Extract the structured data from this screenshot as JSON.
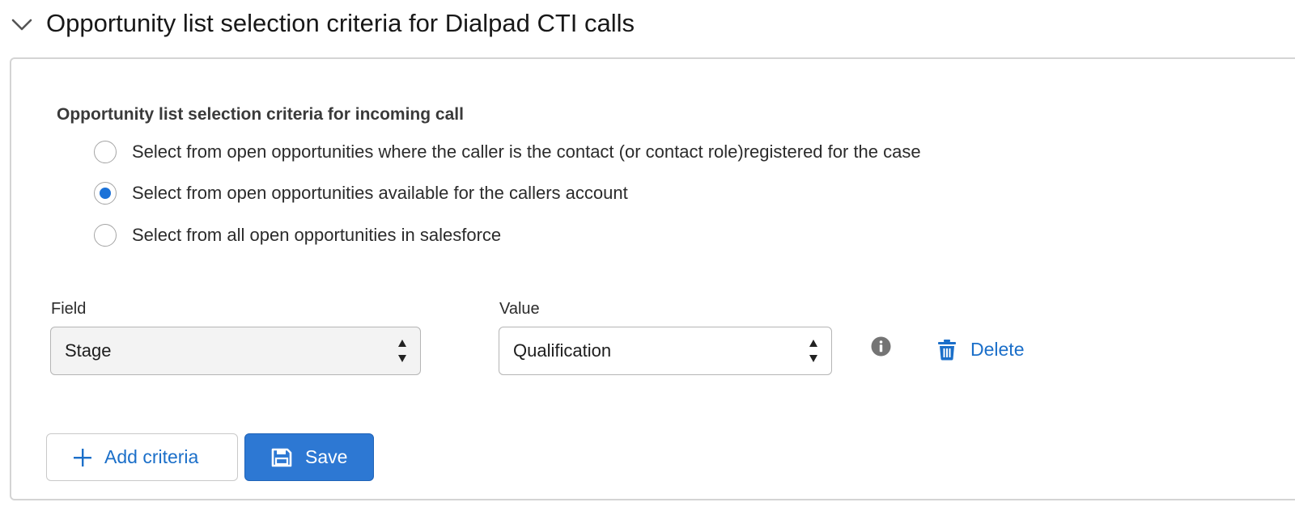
{
  "section": {
    "title": "Opportunity list selection criteria for Dialpad CTI calls",
    "expanded": true
  },
  "criteria": {
    "group_label": "Opportunity list selection criteria for incoming call",
    "options": [
      {
        "label": "Select from open opportunities where the caller is the contact (or contact role)registered for the case",
        "checked": false
      },
      {
        "label": "Select from open opportunities available for the callers account",
        "checked": true
      },
      {
        "label": "Select from all open opportunities in salesforce",
        "checked": false
      }
    ]
  },
  "filter": {
    "field_label": "Field",
    "field_value": "Stage",
    "value_label": "Value",
    "value_value": "Qualification",
    "delete_label": "Delete"
  },
  "actions": {
    "add_label": "Add criteria",
    "save_label": "Save"
  },
  "colors": {
    "accent": "#1b72d8",
    "link": "#1b6fc9",
    "primary_button": "#2d78d3"
  },
  "icons": {
    "collapse": "chevron-down-icon",
    "info": "info-icon",
    "delete": "trash-icon",
    "add": "plus-icon",
    "save": "save-icon"
  }
}
